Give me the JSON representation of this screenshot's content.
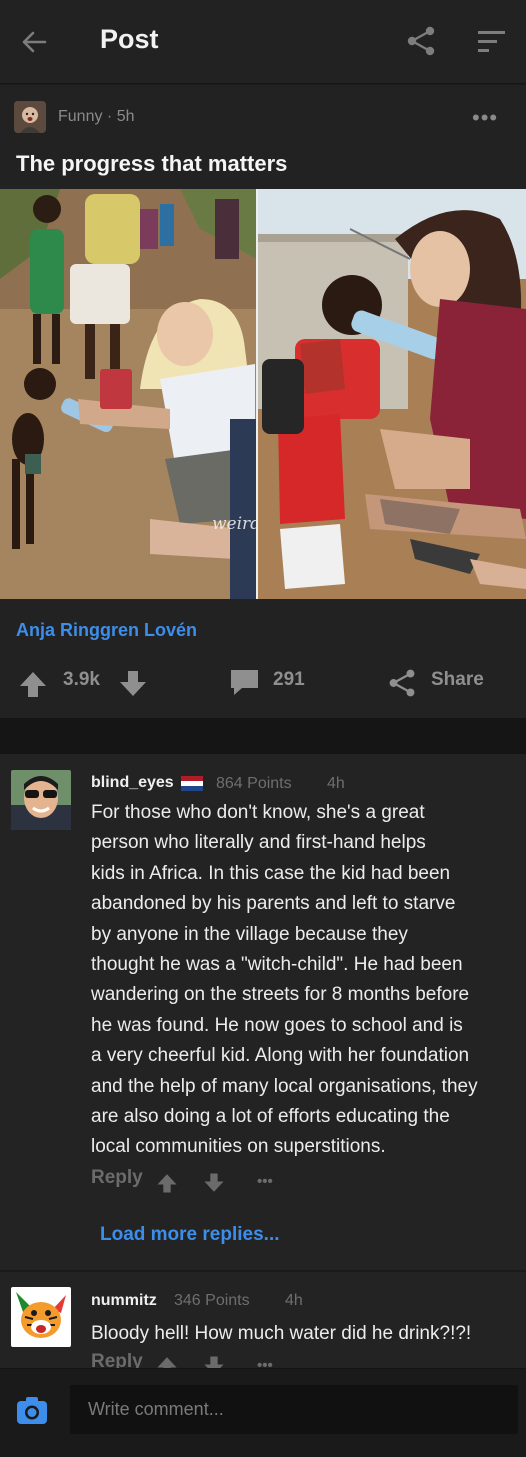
{
  "header": {
    "title": "Post"
  },
  "post": {
    "meta": "Funny · 5h",
    "title": "The progress that matters",
    "watermark": "weirdworld",
    "source": "Anja Ringgren Lovén",
    "votes": "3.9k",
    "comments": "291",
    "share_label": "Share"
  },
  "comments": [
    {
      "username": "blind_eyes",
      "flag": "Netherlands flag",
      "points": "864 Points",
      "time": "4h",
      "lines": [
        "For those who don't know, she's a great",
        "person who literally and first-hand helps",
        "kids in Africa. In this case the kid had been",
        "abandoned by his parents and left to starve",
        "by anyone in the village because they",
        "thought he was a \"witch-child\". He had been",
        "wandering on the streets for 8 months before",
        "he was found. He now goes to school and is",
        "a very cheerful kid. Along with her foundation",
        "and the help of many local organisations, they",
        "are also doing a lot of efforts educating the",
        "local communities on superstitions."
      ],
      "reply_label": "Reply",
      "more": "•••"
    },
    {
      "username": "nummitz",
      "points": "346 Points",
      "time": "4h",
      "text": "Bloody hell! How much water did he drink?!?!",
      "reply_label": "Reply",
      "more": "•••"
    }
  ],
  "load_more": "Load more replies...",
  "composer": {
    "placeholder": "Write comment..."
  },
  "colors": {
    "background": "#1b1b1b",
    "surface": "#222222",
    "accent_blue": "#3d8eea",
    "muted": "#8f8f8f"
  },
  "icons": [
    "back-arrow-icon",
    "share-icon",
    "sort-icon",
    "more-icon",
    "upvote-icon",
    "downvote-icon",
    "comment-icon",
    "camera-icon"
  ]
}
